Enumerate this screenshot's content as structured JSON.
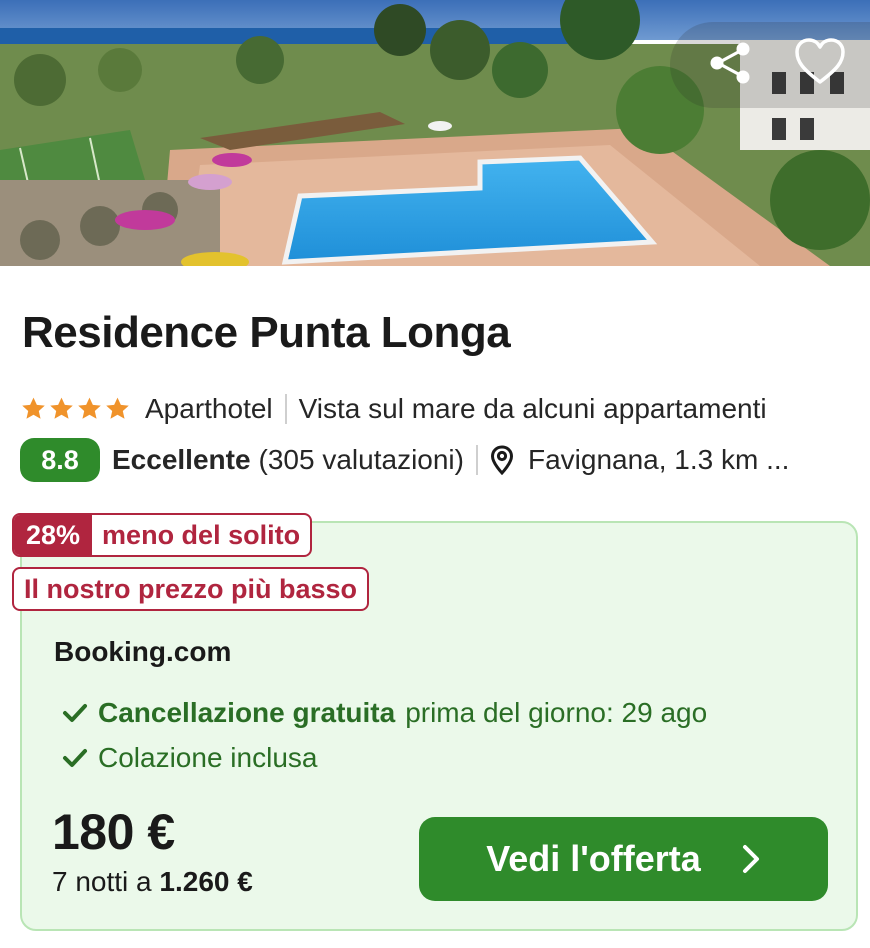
{
  "hero": {
    "share_icon": "share-icon",
    "favorite_icon": "heart-outline-icon"
  },
  "hotel": {
    "name": "Residence Punta Longa",
    "stars": 4,
    "star_color": "#f0932b",
    "type": "Aparthotel",
    "feature": "Vista sul mare da alcuni appartamenti",
    "rating_score": "8.8",
    "rating_word": "Eccellente",
    "reviews": "(305 valutazioni)",
    "location_icon": "map-pin-icon",
    "location": "Favignana, 1.3 km ..."
  },
  "deal": {
    "discount_pct": "28%",
    "discount_text": "meno del solito",
    "lowest_price_text": "Il nostro prezzo più basso",
    "provider": "Booking.com",
    "cancellation_bold": "Cancellazione gratuita",
    "cancellation_rest": "prima del giorno: 29 ago",
    "breakfast": "Colazione inclusa",
    "price": "180 €",
    "total_prefix": "7 notti a",
    "total_amount": "1.260 €",
    "cta_label": "Vedi l'offerta",
    "colors": {
      "accent_green": "#2f8b2b",
      "deal_red": "#b0253f",
      "card_bg": "#ebf9ea",
      "card_border": "#b9e5b5"
    }
  }
}
